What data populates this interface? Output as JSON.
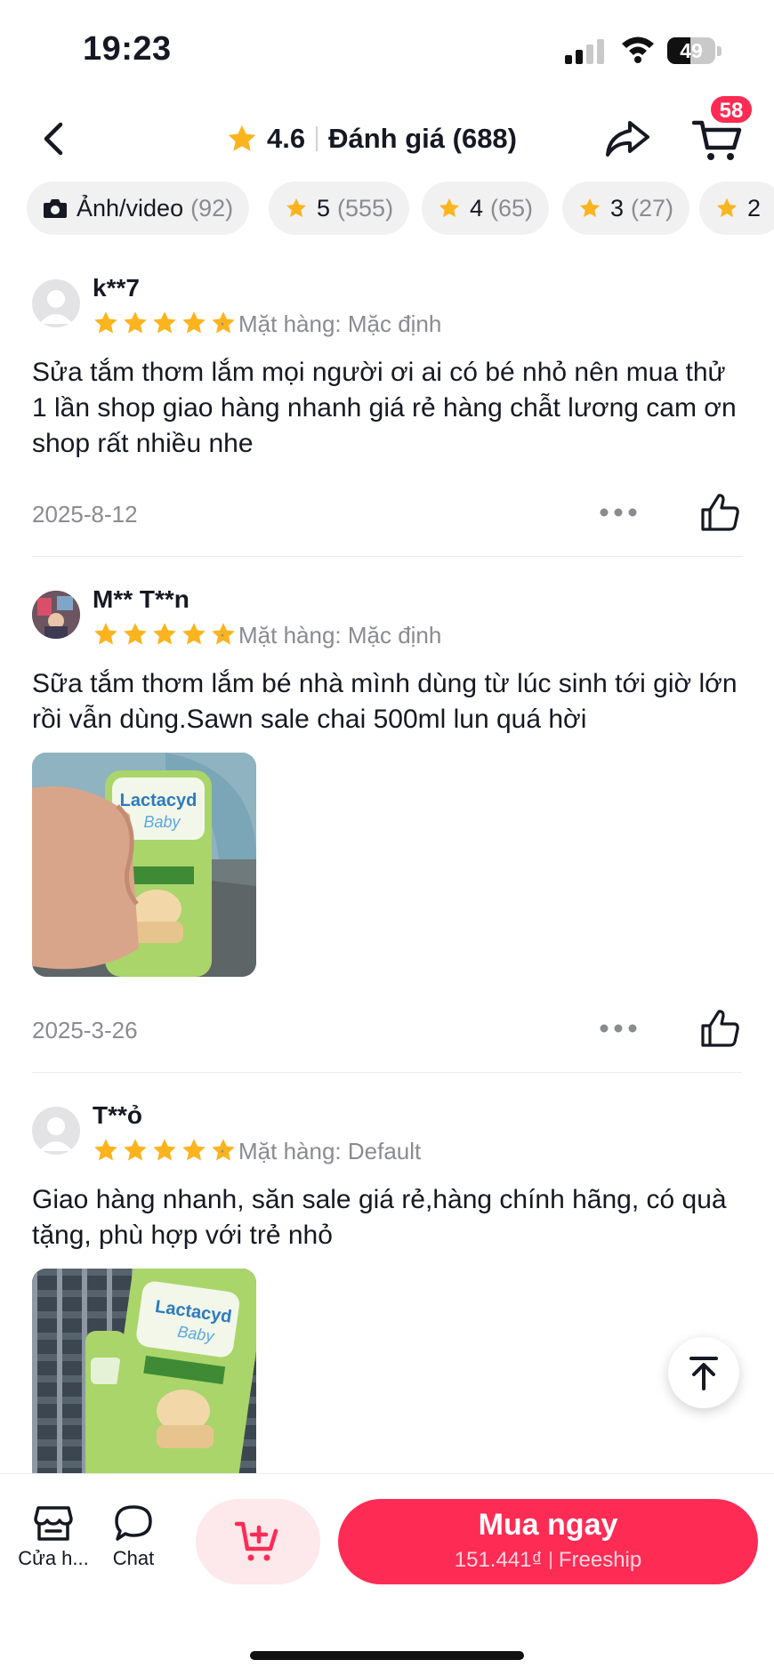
{
  "status_bar": {
    "time": "19:23",
    "battery_level": "49",
    "battery_fraction": 0.49
  },
  "header": {
    "rating": "4.6",
    "title": "Đánh giá (688)",
    "cart_badge": "58"
  },
  "filters": [
    {
      "label": "Ảnh/video",
      "count": "(92)",
      "icon": "camera-icon"
    },
    {
      "label": "5",
      "count": "(555)",
      "icon": "star-icon"
    },
    {
      "label": "4",
      "count": "(65)",
      "icon": "star-icon"
    },
    {
      "label": "3",
      "count": "(27)",
      "icon": "star-icon"
    },
    {
      "label": "2",
      "count": "",
      "icon": "star-icon"
    }
  ],
  "reviews": [
    {
      "username": "k**7",
      "stars": 5,
      "variant": "Mặt hàng: Mặc định",
      "text": "Sửa tắm thơm lắm mọi người ơi ai có bé nhỏ nên mua thử 1 lần shop giao hàng nhanh giá rẻ hàng chẫt lương cam ơn shop rất nhiều nhe",
      "date": "2025-8-12"
    },
    {
      "username": "M** T**n",
      "stars": 5,
      "variant": "Mặt hàng: Mặc định",
      "text": "Sữa tắm thơm lắm bé nhà mình dùng từ lúc sinh tới giờ lớn rồi vẫn dùng.Sawn sale chai 500ml lun quá hời",
      "photo_brand": "Lactacyd",
      "photo_sub": "Baby",
      "date": "2025-3-26"
    },
    {
      "username": "T**ỏ",
      "stars": 5,
      "variant": "Mặt hàng: Default",
      "text": "Giao hàng nhanh, săn sale giá rẻ,hàng chính hãng, có quà tặng, phù hợp với trẻ nhỏ",
      "photo_brand": "Lactacyd",
      "photo_sub": "Baby"
    }
  ],
  "bottom_bar": {
    "shop_label": "Cửa h...",
    "chat_label": "Chat",
    "buy_label": "Mua ngay",
    "price": "151.441₫",
    "shipping": "Freeship"
  },
  "colors": {
    "accent": "#fe2c55",
    "star": "#fbb41e",
    "muted": "#8a8b91"
  }
}
